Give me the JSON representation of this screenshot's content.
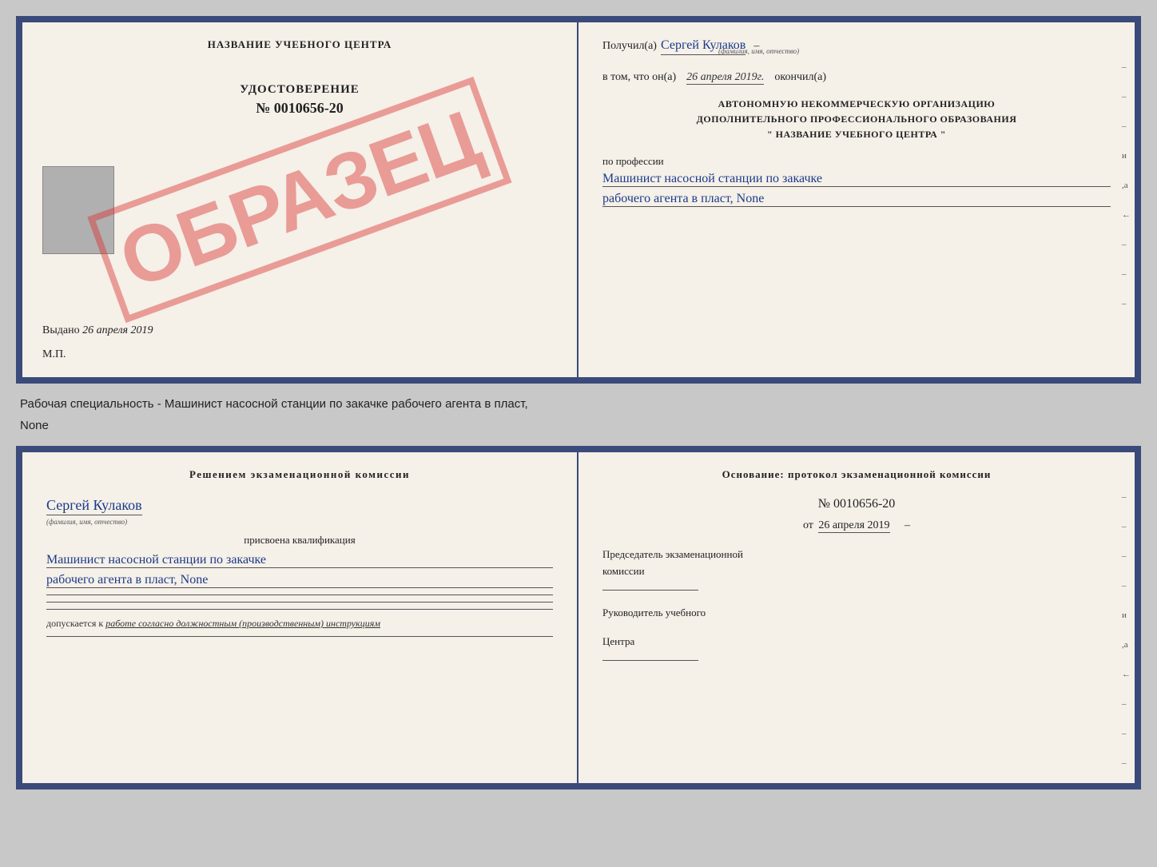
{
  "top_doc": {
    "left": {
      "center_title": "НАЗВАНИЕ УЧЕБНОГО ЦЕНТРА",
      "udostoverenie_label": "УДОСТОВЕРЕНИЕ",
      "number": "№ 0010656-20",
      "vydano_label": "Выдано",
      "vydano_date": "26 апреля 2019",
      "mp_label": "М.П.",
      "obrazec": "ОБРАЗЕЦ"
    },
    "right": {
      "poluchil_label": "Получил(а)",
      "poluchil_name": "Сергей Кулаков",
      "familiya_hint": "(фамилия, имя, отчество)",
      "vtom_label": "в том, что он(а)",
      "vtom_date": "26 апреля 2019г.",
      "okonchil_label": "окончил(а)",
      "org_line1": "АВТОНОМНУЮ НЕКОММЕРЧЕСКУЮ ОРГАНИЗАЦИЮ",
      "org_line2": "ДОПОЛНИТЕЛЬНОГО ПРОФЕССИОНАЛЬНОГО ОБРАЗОВАНИЯ",
      "org_line3": "\"  НАЗВАНИЕ УЧЕБНОГО ЦЕНТРА  \"",
      "po_professii_label": "по профессии",
      "profession_line1": "Машинист насосной станции по закачке",
      "profession_line2": "рабочего агента в пласт, None",
      "side_marks": [
        "-",
        "-",
        "-",
        "и",
        ",а",
        "←",
        "-",
        "-",
        "-"
      ]
    }
  },
  "info_text": "Рабочая специальность - Машинист насосной станции по закачке рабочего агента в пласт,",
  "info_text2": "None",
  "bottom_doc": {
    "left": {
      "resheniem_text": "Решением  экзаменационной  комиссии",
      "name": "Сергей Кулаков",
      "familiya_hint": "(фамилия, имя, отчество)",
      "prisvoyena_label": "присвоена квалификация",
      "qual_line1": "Машинист насосной станции по закачке",
      "qual_line2": "рабочего агента в пласт, None",
      "dopuskaetsya_label": "допускается к",
      "dopuskaetsya_value": "работе согласно должностным (производственным) инструкциям"
    },
    "right": {
      "osnovanie_text": "Основание:  протокол  экзаменационной  комиссии",
      "protocol_number": "№  0010656-20",
      "protocol_date_prefix": "от",
      "protocol_date": "26 апреля 2019",
      "predsedatel_line1": "Председатель экзаменационной",
      "predsedatel_line2": "комиссии",
      "rukovoditel_line1": "Руководитель учебного",
      "rukovoditel_line2": "Центра",
      "side_marks": [
        "-",
        "-",
        "-",
        "-",
        "и",
        ",а",
        "←",
        "-",
        "-",
        "-",
        "-"
      ]
    }
  }
}
